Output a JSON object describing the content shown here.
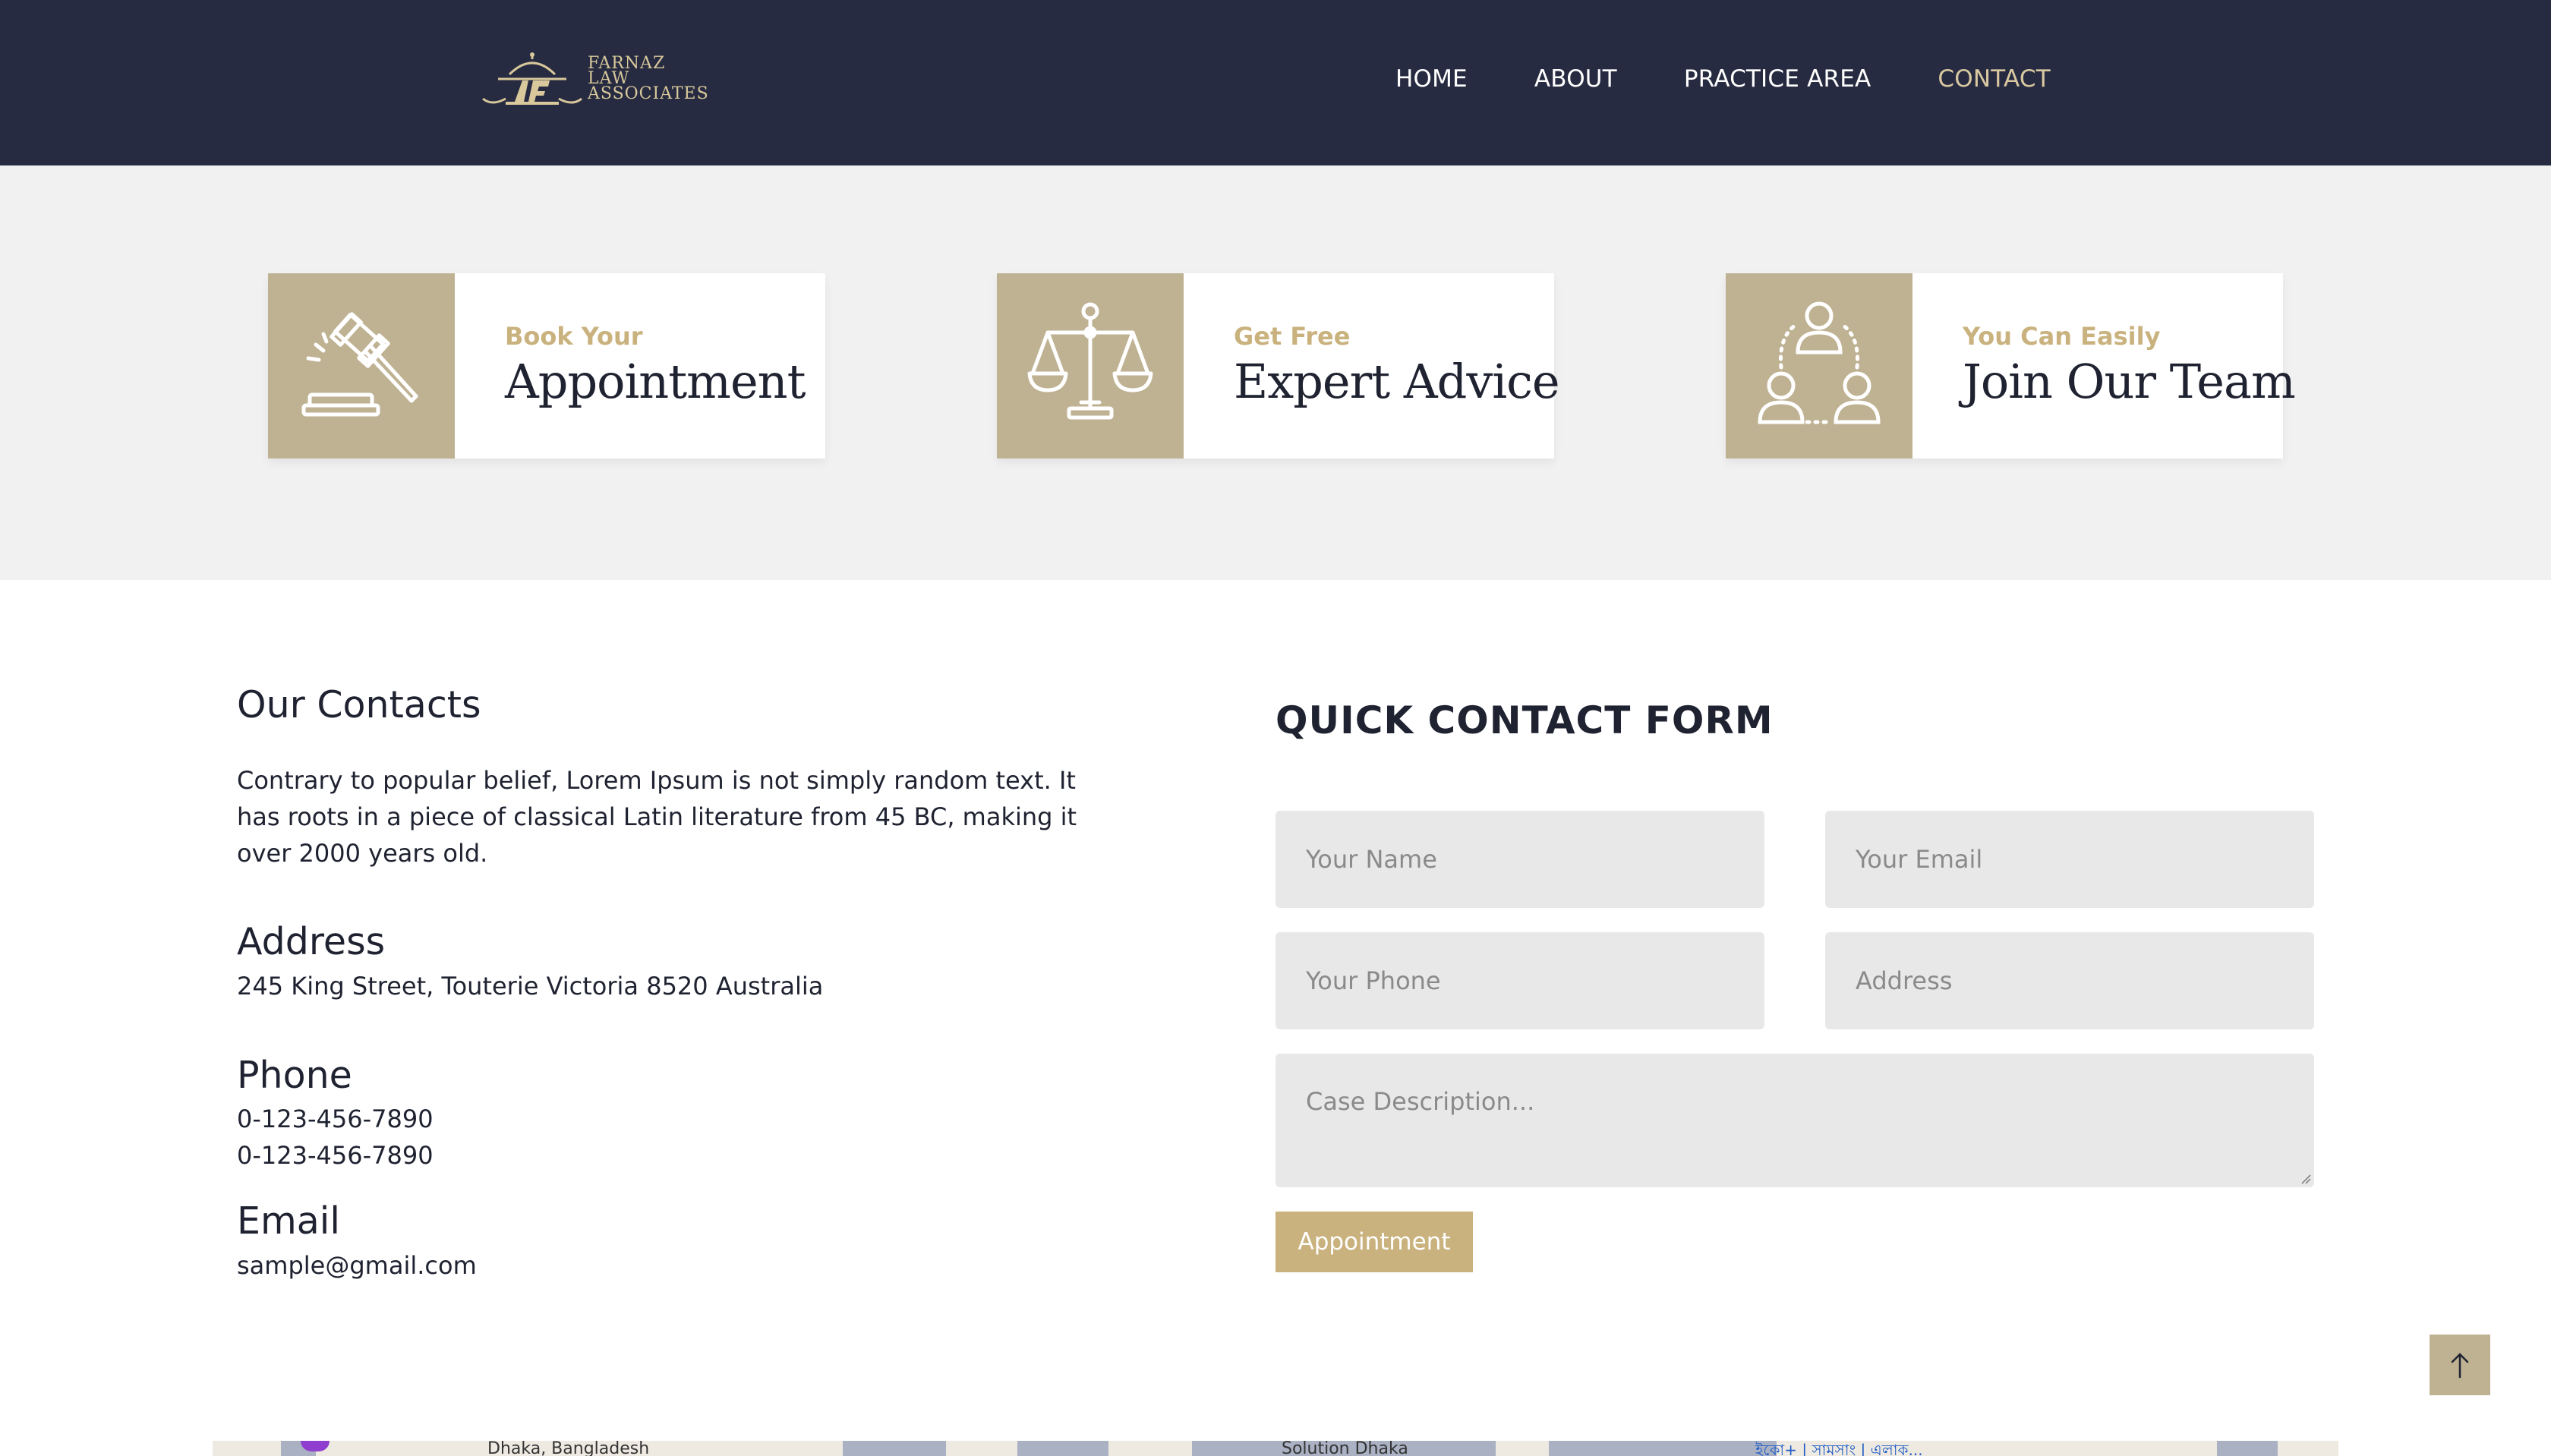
{
  "header": {
    "logo": {
      "line1": "FARNAZ",
      "line2": "LAW",
      "line3": "ASSOCIATES"
    },
    "nav": [
      {
        "label": "HOME",
        "active": false
      },
      {
        "label": "ABOUT",
        "active": false
      },
      {
        "label": "PRACTICE AREA",
        "active": false
      },
      {
        "label": "CONTACT",
        "active": true
      }
    ]
  },
  "services": [
    {
      "subtitle": "Book Your",
      "title": "Appointment",
      "icon": "gavel-icon"
    },
    {
      "subtitle": "Get Free",
      "title": "Expert Advice",
      "icon": "scales-icon"
    },
    {
      "subtitle": "You Can Easily",
      "title": "Join Our Team",
      "icon": "team-icon"
    }
  ],
  "contacts": {
    "heading": "Our Contacts",
    "description": "Contrary to popular belief, Lorem Ipsum is not simply random text. It has roots in a piece of classical Latin literature from 45 BC, making it over 2000 years old.",
    "address_label": "Address",
    "address": "245 King Street, Touterie Victoria 8520 Australia",
    "phone_label": "Phone",
    "phones": [
      "0-123-456-7890",
      "0-123-456-7890"
    ],
    "email_label": "Email",
    "email": "sample@gmail.com"
  },
  "form": {
    "title": "QUICK CONTACT FORM",
    "name_placeholder": "Your Name",
    "email_placeholder": "Your Email",
    "phone_placeholder": "Your Phone",
    "address_placeholder": "Address",
    "description_placeholder": "Case Description...",
    "submit_label": "Appointment"
  },
  "map": {
    "label_1": "Dhaka, Bangladesh",
    "label_2": "Solution Dhaka",
    "label_3": "ইকো+ | সামসাং | এলাক..."
  },
  "colors": {
    "header_bg": "#272b41",
    "accent": "#c9b27e",
    "icon_bg": "#bfb293",
    "band_bg": "#f1f1f1",
    "field_bg": "#e8e8e8"
  }
}
